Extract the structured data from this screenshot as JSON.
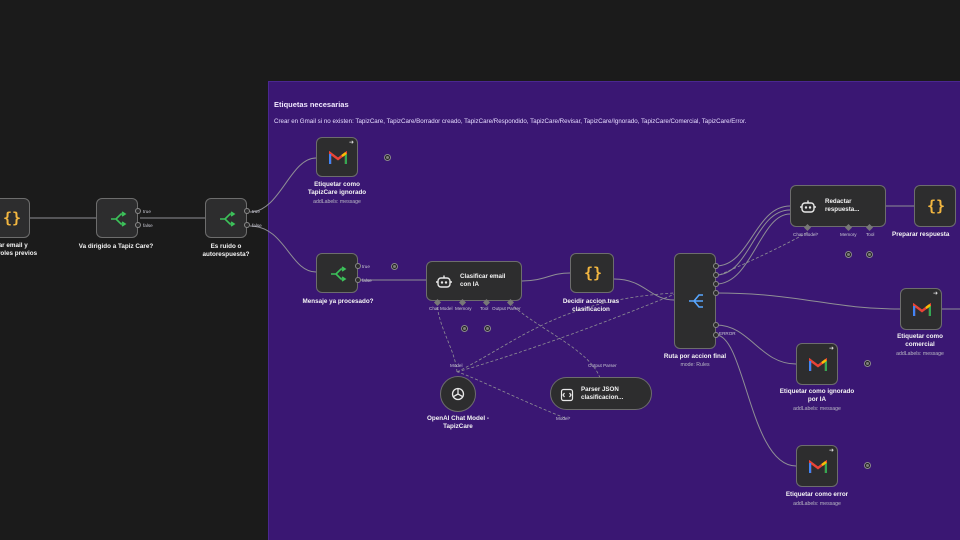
{
  "sticky": {
    "title": "Etiquetas necesarias",
    "body": "Crear en Gmail si no existen: TapizCare, TapizCare/Borrador creado, TapizCare/Respondido, TapizCare/Revisar, TapizCare/Ignorado, TapizCare/Comercial, TapizCare/Error."
  },
  "nodes": {
    "normalize": {
      "label": "lizar email y\nntroles previos"
    },
    "va_dirigido": {
      "label": "Va dirigido a Tapiz Care?",
      "true_out": "true",
      "false_out": "false"
    },
    "es_ruido": {
      "label": "Es ruido o\nautorespuesta?",
      "true_out": "true",
      "false_out": "false"
    },
    "etiquetar_ignorado": {
      "label": "Etiquetar como\nTapizCare ignorado",
      "sub": "addLabels: message"
    },
    "mensaje_procesado": {
      "label": "Mensaje ya procesado?",
      "true_out": "true",
      "false_out": "false"
    },
    "clasificar": {
      "label": "Clasificar email\ncon IA",
      "ports": [
        "Chat Model",
        "Memory",
        "Tool",
        "Output Parser"
      ]
    },
    "decidir": {
      "label": "Decidir accion tras\nclasificacion"
    },
    "ruta": {
      "label": "Ruta por accion final",
      "sub": "mode: Rules",
      "fallback": "ERROR"
    },
    "openai": {
      "label": "OpenAI Chat Model -\nTapizCare",
      "port_top": "Model",
      "port_bottom": "Model*"
    },
    "parser": {
      "label": "Parser JSON\nclasificacion...",
      "port_top": "Output Parser"
    },
    "redactar": {
      "label": "Redactar\nrespuesta...",
      "ports": [
        "Chat Model*",
        "Memory",
        "Tool"
      ]
    },
    "preparar": {
      "label": "Preparar respuesta"
    },
    "etiquetar_comercial": {
      "label": "Etiquetar como\ncomercial",
      "sub": "addLabels: message"
    },
    "etiquetar_ignorado_ia": {
      "label": "Etiquetar como ignorado\npor IA",
      "sub": "addLabels: message"
    },
    "etiquetar_error": {
      "label": "Etiquetar como error",
      "sub": "addLabels: message"
    }
  },
  "icons": {
    "code": "braces-icon",
    "if": "branch-icon",
    "gmail": "gmail-icon",
    "ai": "robot-icon",
    "openai": "openai-icon",
    "parser": "parser-icon",
    "switch": "switch-icon"
  },
  "colors": {
    "canvas": "#1b1b1b",
    "sticky": "#3a1773",
    "node": "#2d2d2e",
    "wire": "#8f8f95",
    "if_green": "#3cc25a",
    "code_orange": "#f2b640",
    "switch_blue": "#58a6ff"
  }
}
